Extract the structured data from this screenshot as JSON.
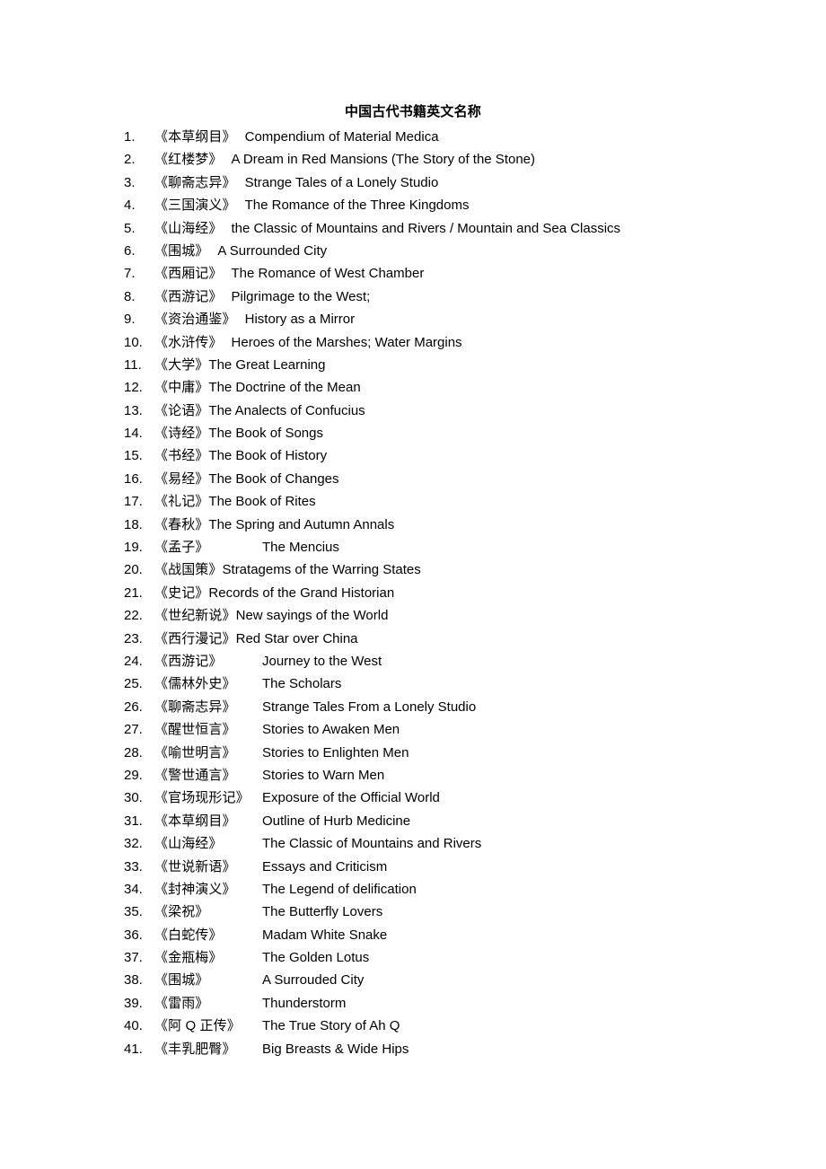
{
  "document": {
    "title": "中国古代书籍英文名称"
  },
  "books": [
    {
      "num": "1.",
      "cn": "《本草纲目》",
      "en": "Compendium of Material Medica",
      "layout": "flow",
      "gap": "gap-md"
    },
    {
      "num": "2.",
      "cn": "《红楼梦》",
      "en": "A Dream in Red Mansions (The Story of the Stone)",
      "layout": "flow",
      "gap": "gap-md"
    },
    {
      "num": "3.",
      "cn": "《聊斋志异》",
      "en": "Strange Tales of a Lonely Studio",
      "layout": "flow",
      "gap": "gap-md"
    },
    {
      "num": "4.",
      "cn": "《三国演义》",
      "en": "The Romance of the Three Kingdoms",
      "layout": "flow",
      "gap": "gap-md"
    },
    {
      "num": "5.",
      "cn": "《山海经》",
      "en": "the Classic of Mountains and Rivers / Mountain and Sea Classics",
      "layout": "flow",
      "gap": "gap-md"
    },
    {
      "num": "6.",
      "cn": "《围城》",
      "en": "A Surrounded City",
      "layout": "flow",
      "gap": "gap-md"
    },
    {
      "num": "7.",
      "cn": "《西厢记》",
      "en": "The Romance of West Chamber",
      "layout": "flow",
      "gap": "gap-md"
    },
    {
      "num": "8.",
      "cn": "《西游记》",
      "en": "Pilgrimage to the West;",
      "layout": "flow",
      "gap": "gap-md"
    },
    {
      "num": "9.",
      "cn": "《资治通鉴》",
      "en": "History as a Mirror",
      "layout": "flow",
      "gap": "gap-md"
    },
    {
      "num": "10.",
      "cn": "《水浒传》",
      "en": "Heroes of the Marshes; Water Margins",
      "layout": "flow",
      "gap": "gap-md"
    },
    {
      "num": "11.",
      "cn": "《大学》",
      "en": "The Great Learning",
      "layout": "flow",
      "gap": "gap-none"
    },
    {
      "num": "12.",
      "cn": "《中庸》",
      "en": "The Doctrine of the Mean",
      "layout": "flow",
      "gap": "gap-none"
    },
    {
      "num": "13.",
      "cn": "《论语》",
      "en": "The Analects of Confucius",
      "layout": "flow",
      "gap": "gap-none"
    },
    {
      "num": "14.",
      "cn": "《诗经》",
      "en": "The Book of Songs",
      "layout": "flow",
      "gap": "gap-none"
    },
    {
      "num": "15.",
      "cn": "《书经》",
      "en": "The Book of History",
      "layout": "flow",
      "gap": "gap-none"
    },
    {
      "num": "16.",
      "cn": "《易经》",
      "en": "The Book of Changes",
      "layout": "flow",
      "gap": "gap-none"
    },
    {
      "num": "17.",
      "cn": "《礼记》",
      "en": "The Book of Rites",
      "layout": "flow",
      "gap": "gap-none"
    },
    {
      "num": "18.",
      "cn": "《春秋》",
      "en": "The Spring and Autumn Annals",
      "layout": "flow",
      "gap": "gap-none"
    },
    {
      "num": "19.",
      "cn": "《孟子》",
      "en": "The Mencius",
      "layout": "tabbed",
      "gap": "gap-none"
    },
    {
      "num": "20.",
      "cn": "《战国策》",
      "en": "Stratagems of the Warring States",
      "layout": "flow",
      "gap": "gap-none"
    },
    {
      "num": "21.",
      "cn": "《史记》",
      "en": "Records of the Grand Historian",
      "layout": "flow",
      "gap": "gap-none"
    },
    {
      "num": "22.",
      "cn": "《世纪新说》",
      "en": "New sayings of the World",
      "layout": "flow",
      "gap": "gap-none"
    },
    {
      "num": "23.",
      "cn": "《西行漫记》",
      "en": "Red Star over China",
      "layout": "flow",
      "gap": "gap-none"
    },
    {
      "num": "24.",
      "cn": "《西游记》",
      "en": "Journey to the West",
      "layout": "tabbed",
      "gap": "gap-none"
    },
    {
      "num": "25.",
      "cn": "《儒林外史》",
      "en": "The Scholars",
      "layout": "tabbed",
      "gap": "gap-none"
    },
    {
      "num": "26.",
      "cn": "《聊斋志异》",
      "en": "Strange Tales From a Lonely Studio",
      "layout": "tabbed",
      "gap": "gap-none"
    },
    {
      "num": "27.",
      "cn": "《醒世恒言》",
      "en": "Stories to Awaken Men",
      "layout": "tabbed",
      "gap": "gap-none"
    },
    {
      "num": "28.",
      "cn": "《喻世明言》",
      "en": "Stories to Enlighten Men",
      "layout": "tabbed",
      "gap": "gap-none"
    },
    {
      "num": "29.",
      "cn": "《警世通言》",
      "en": "Stories to Warn Men",
      "layout": "tabbed",
      "gap": "gap-none"
    },
    {
      "num": "30.",
      "cn": "《官场现形记》",
      "en": "Exposure of the Official World",
      "layout": "tabbed",
      "gap": "gap-none"
    },
    {
      "num": "31.",
      "cn": "《本草纲目》",
      "en": "Outline of Hurb Medicine",
      "layout": "tabbed",
      "gap": "gap-none"
    },
    {
      "num": "32.",
      "cn": "《山海经》",
      "en": "The Classic of Mountains and Rivers",
      "layout": "tabbed",
      "gap": "gap-none"
    },
    {
      "num": "33.",
      "cn": "《世说新语》",
      "en": "Essays and Criticism",
      "layout": "tabbed",
      "gap": "gap-none"
    },
    {
      "num": "34.",
      "cn": "《封神演义》",
      "en": "The Legend of delification",
      "layout": "tabbed",
      "gap": "gap-none"
    },
    {
      "num": "35.",
      "cn": "《梁祝》",
      "en": "The Butterfly Lovers",
      "layout": "tabbed",
      "gap": "gap-none"
    },
    {
      "num": "36.",
      "cn": "《白蛇传》",
      "en": "Madam White Snake",
      "layout": "tabbed",
      "gap": "gap-none"
    },
    {
      "num": "37.",
      "cn": "《金瓶梅》",
      "en": "The Golden Lotus",
      "layout": "tabbed",
      "gap": "gap-none"
    },
    {
      "num": "38.",
      "cn": "《围城》",
      "en": "A Surrouded City",
      "layout": "tabbed",
      "gap": "gap-none"
    },
    {
      "num": "39.",
      "cn": "《雷雨》",
      "en": "Thunderstorm",
      "layout": "tabbed",
      "gap": "gap-none"
    },
    {
      "num": "40.",
      "cn": "《阿 Q 正传》",
      "en": "The True Story of Ah Q",
      "layout": "tabbed",
      "gap": "gap-none"
    },
    {
      "num": "41.",
      "cn": "《丰乳肥臀》",
      "en": "Big Breasts & Wide Hips",
      "layout": "tabbed",
      "gap": "gap-none"
    }
  ]
}
